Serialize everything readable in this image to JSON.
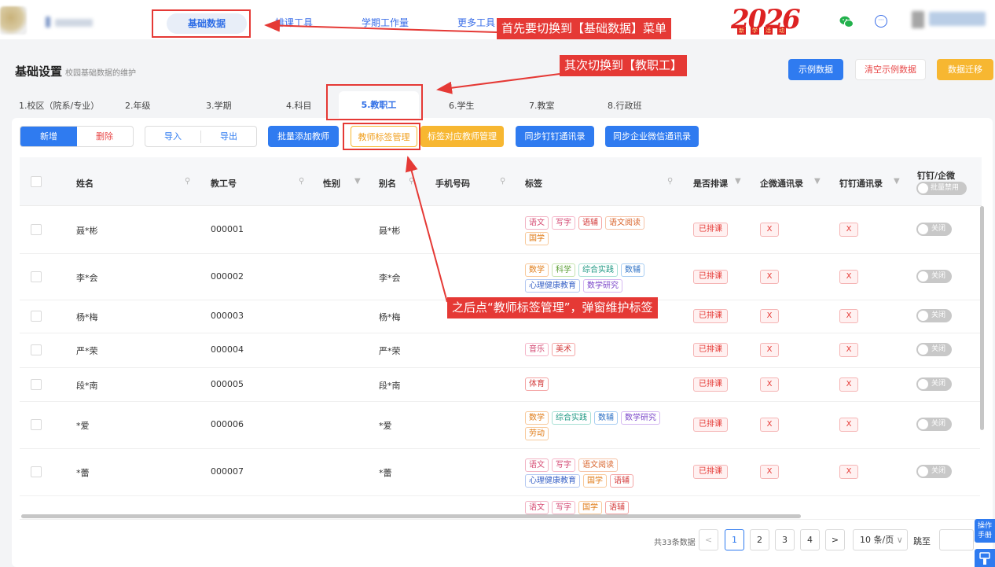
{
  "nav": {
    "items": [
      "基础数据",
      "排课工具",
      "学期工作量",
      "更多工具"
    ],
    "active": "基础数据",
    "badge": {
      "digits": "2026",
      "sub": [
        "新",
        "学",
        "活",
        "动"
      ]
    }
  },
  "annotations": {
    "a1": "首先要切换到【基础数据】菜单",
    "a2": "其次切换到【教职工】",
    "a3": "之后点“教师标签管理”，弹窗维护标签"
  },
  "header": {
    "title": "基础设置",
    "subtitle": "校园基础数据的维护",
    "buttons": [
      "示例数据",
      "清空示例数据",
      "数据迁移"
    ]
  },
  "tabs": [
    "1.校区（院系/专业）",
    "2.年级",
    "3.学期",
    "4.科目",
    "5.教职工",
    "6.学生",
    "7.教室",
    "8.行政班"
  ],
  "toolbar": {
    "add": "新增",
    "delete": "删除",
    "import": "导入",
    "export": "导出",
    "batch_add": "批量添加教师",
    "tag_manage": "教师标签管理",
    "tag_map": "标签对应教师管理",
    "sync_dingtalk": "同步钉钉通讯录",
    "sync_wecom": "同步企业微信通讯录"
  },
  "table": {
    "columns": [
      "姓名",
      "教工号",
      "性别",
      "别名",
      "手机号码",
      "标签",
      "是否排课",
      "企微通讯录",
      "钉钉通讯录",
      "钉钉/企微"
    ],
    "batch_toggle": "批量禁用",
    "rows": [
      {
        "name": "聂*彬",
        "id": "000001",
        "alias": "聂*彬",
        "tags": [
          "语文",
          "写字",
          "语辅",
          "语文阅读",
          "国学"
        ]
      },
      {
        "name": "李*会",
        "id": "000002",
        "alias": "李*会",
        "tags": [
          "数学",
          "科学",
          "综合实践",
          "数辅",
          "心理健康教育",
          "数学研究"
        ]
      },
      {
        "name": "杨*梅",
        "id": "000003",
        "alias": "杨*梅",
        "tags": []
      },
      {
        "name": "严*荣",
        "id": "000004",
        "alias": "严*荣",
        "tags": [
          "音乐",
          "美术"
        ]
      },
      {
        "name": "段*南",
        "id": "000005",
        "alias": "段*南",
        "tags": [
          "体育"
        ]
      },
      {
        "name": "*爱",
        "id": "000006",
        "alias": "*爱",
        "tags": [
          "数学",
          "综合实践",
          "数辅",
          "数学研究",
          "劳动"
        ]
      },
      {
        "name": "*蕾",
        "id": "000007",
        "alias": "*蕾",
        "tags": [
          "语文",
          "写字",
          "语文阅读",
          "心理健康教育",
          "国学",
          "语辅"
        ]
      },
      {
        "name": "",
        "id": "",
        "alias": "",
        "tags": [
          "语文",
          "写字",
          "国学",
          "语辅"
        ]
      }
    ],
    "scheduled": "已排课",
    "x_mark": "X",
    "off": "关闭"
  },
  "pagination": {
    "total": "共33条数据",
    "pages": [
      "1",
      "2",
      "3",
      "4"
    ],
    "active": "1",
    "prev": "<",
    "next": ">",
    "size": "10 条/页",
    "jump": "跳至"
  },
  "side": {
    "manual": "操作手册"
  },
  "colors": {
    "primary": "#2f7bf0",
    "annotation_red": "#e53935",
    "warning": "#f7b731"
  }
}
